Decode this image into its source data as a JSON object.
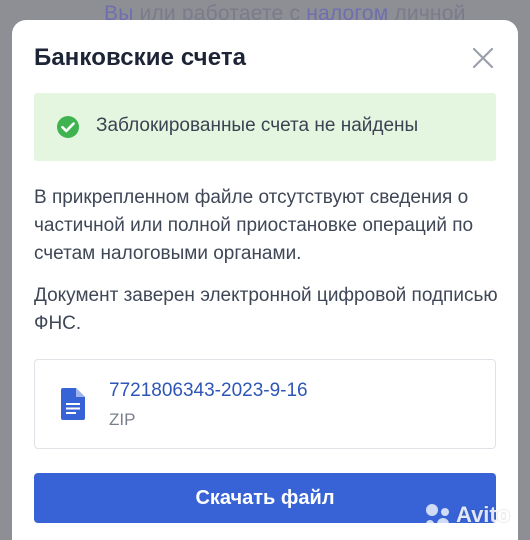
{
  "background": {
    "partial_text_prefix": "Вы",
    "partial_text_middle": " или работаете с ",
    "partial_text_link": "налогом",
    "partial_text_suffix": " личной"
  },
  "modal": {
    "title": "Банковские счета",
    "close_icon": "close-icon",
    "alert": {
      "status": "success",
      "icon": "check-circle-icon",
      "text": "Заблокированные счета не найдены",
      "color": "#e4f6df"
    },
    "paragraphs": [
      "В прикрепленном файле отсутствуют сведения о частичной или полной приостановке операций по счетам налоговыми органами.",
      "Документ заверен электронной цифровой подписью ФНС."
    ],
    "file": {
      "icon": "document-icon",
      "name": "7721806343-2023-9-16",
      "type": "ZIP"
    },
    "download_label": "Скачать файл",
    "accent_color": "#3863d6"
  },
  "watermark": {
    "text": "Avito"
  }
}
